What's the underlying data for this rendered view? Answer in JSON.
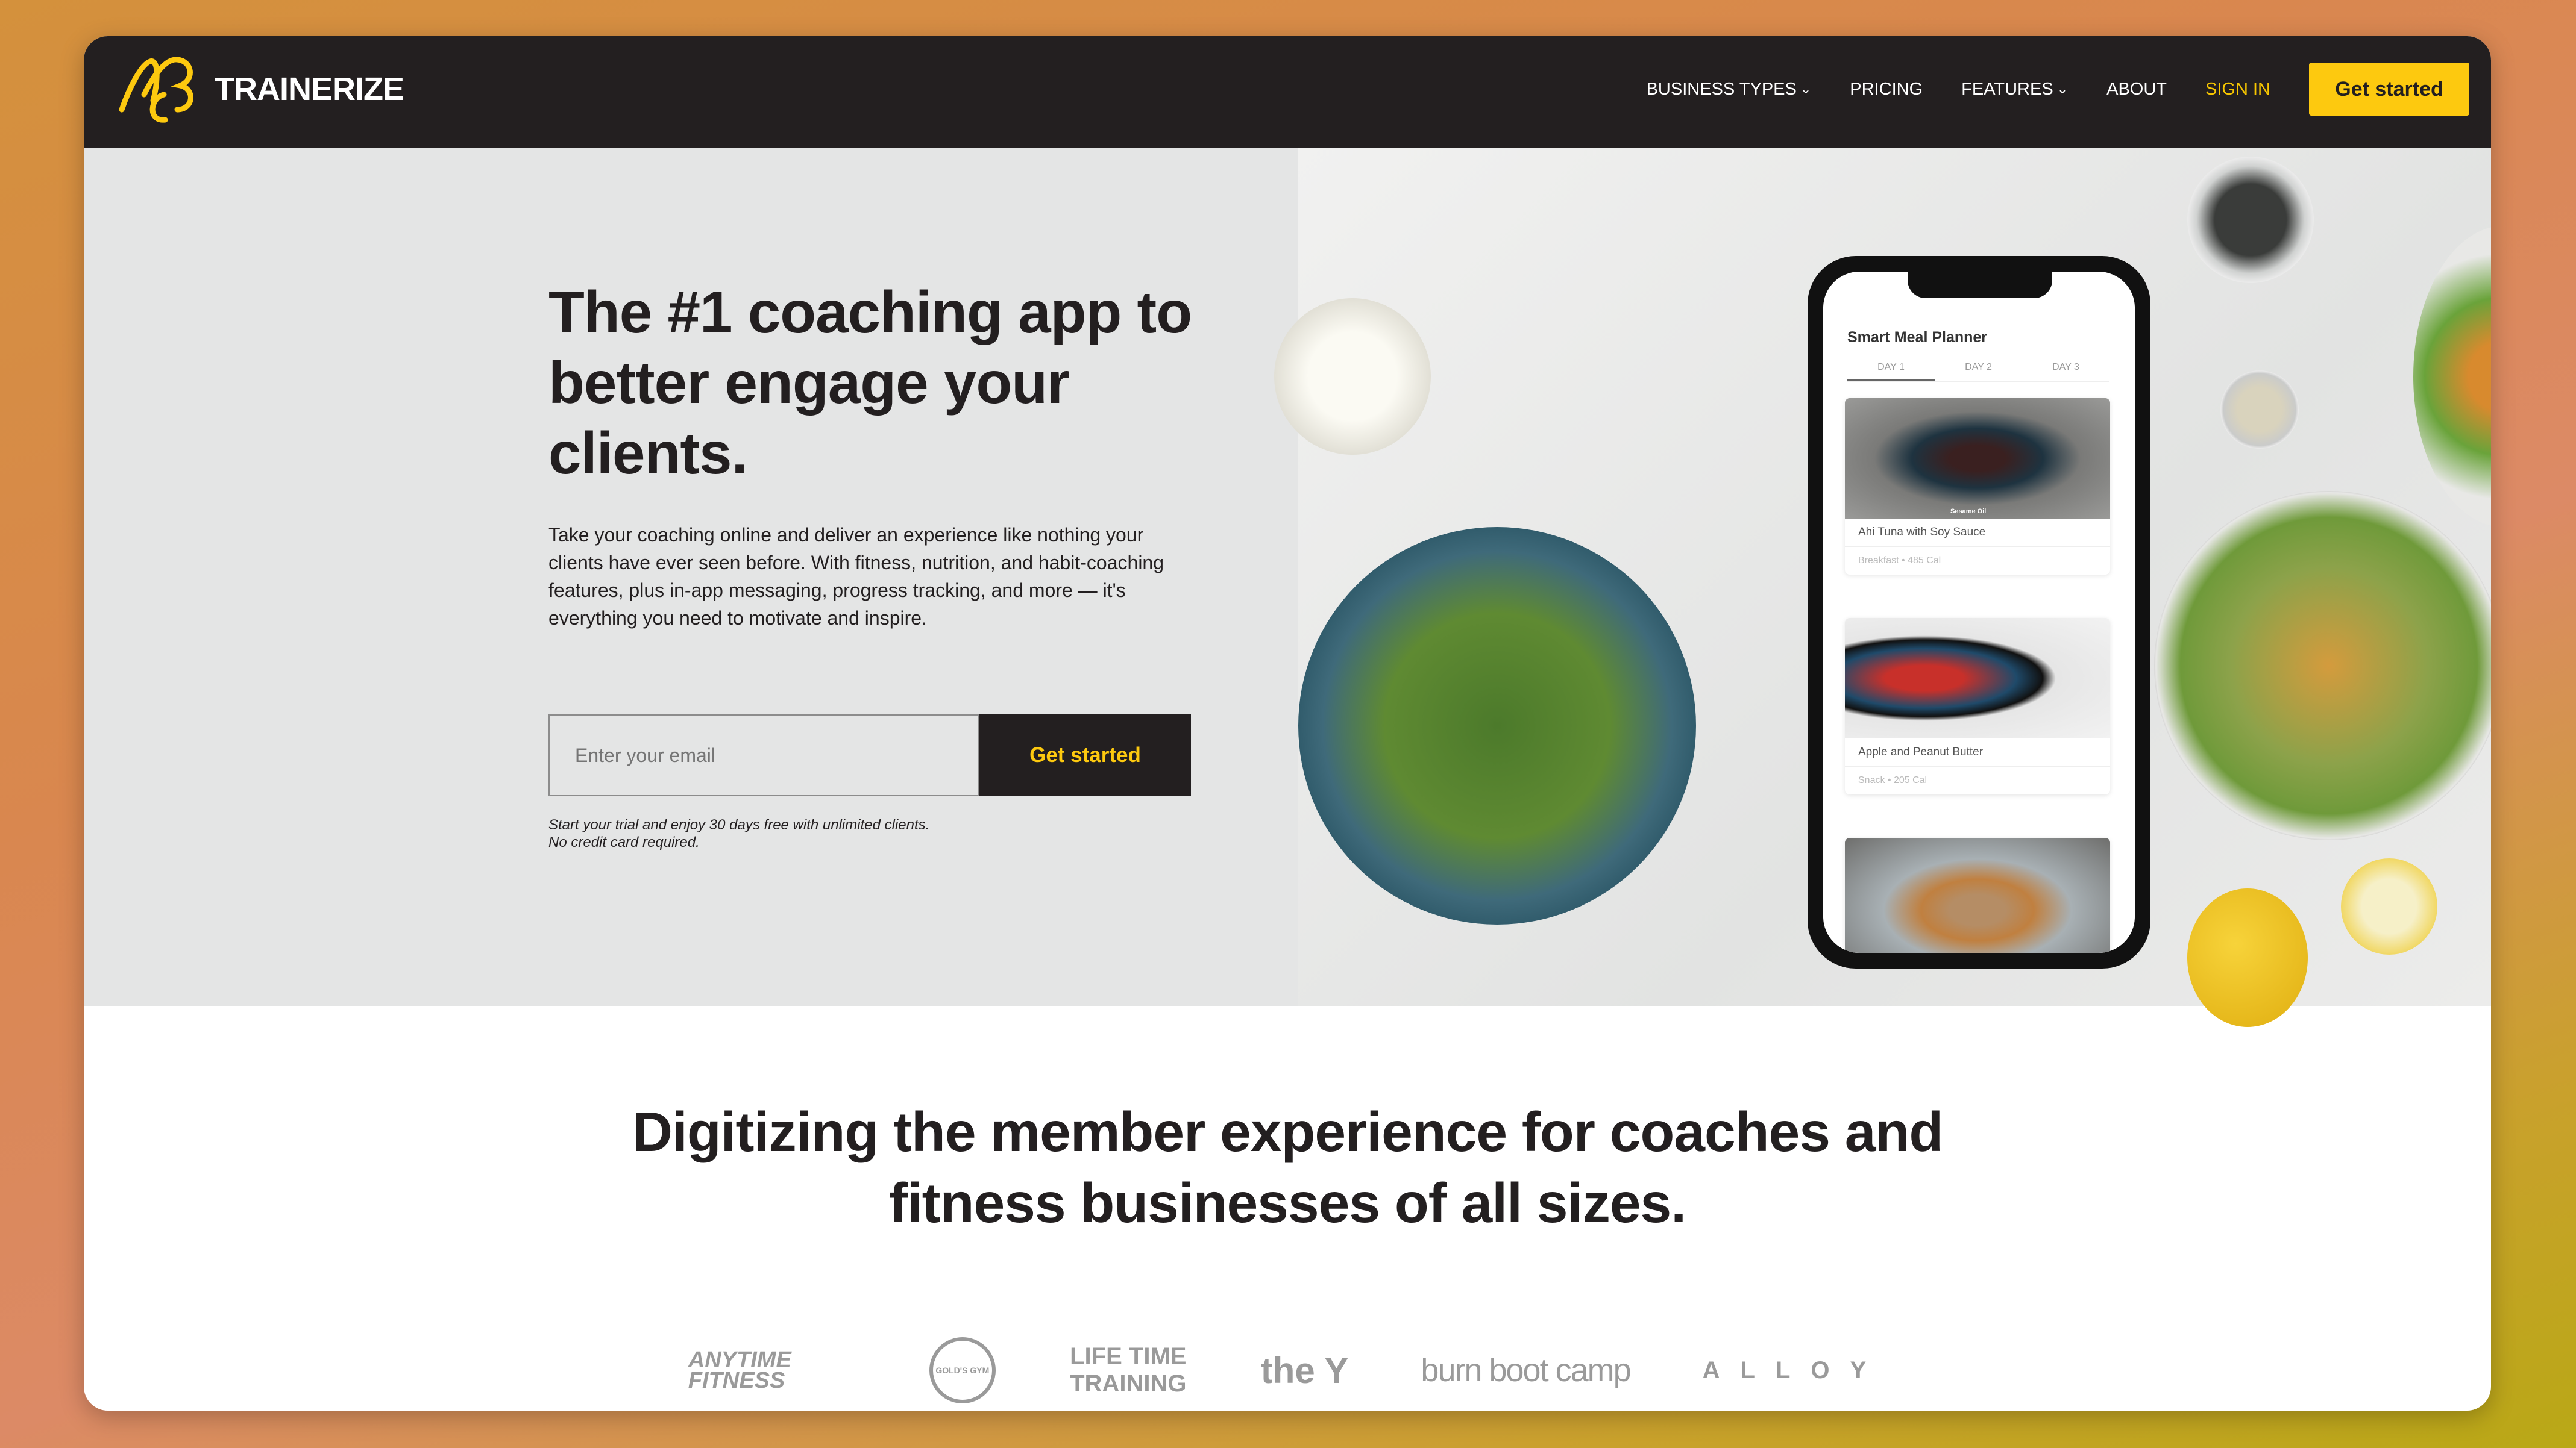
{
  "nav": {
    "brand": "TRAINERIZE",
    "items": [
      {
        "label": "BUSINESS TYPES",
        "dropdown": true
      },
      {
        "label": "PRICING",
        "dropdown": false
      },
      {
        "label": "FEATURES",
        "dropdown": true
      },
      {
        "label": "ABOUT",
        "dropdown": false
      }
    ],
    "sign_in": "SIGN IN",
    "cta": "Get started"
  },
  "hero": {
    "title": "The #1 coaching app to better engage your clients.",
    "lead": "Take your coaching online and deliver an experience like nothing your clients have ever seen before. With fitness, nutrition, and habit-coaching features, plus in-app messaging, progress tracking, and more — it's everything you need to motivate and inspire.",
    "email_placeholder": "Enter your email",
    "email_value": "",
    "cta": "Get started",
    "note_line1": "Start your trial and enjoy 30 days free with unlimited clients.",
    "note_line2": "No credit card required."
  },
  "phone": {
    "title": "Smart Meal Planner",
    "tabs": [
      "DAY 1",
      "DAY 2",
      "DAY 3"
    ],
    "meals": [
      {
        "name": "Ahi Tuna with Soy Sauce",
        "meta": "Breakfast • 485 Cal",
        "image_label": "Sesame Oil"
      },
      {
        "name": "Apple and Peanut Butter",
        "meta": "Snack • 205 Cal"
      }
    ]
  },
  "section2": {
    "title_line1": "Digitizing the member experience for coaches and",
    "title_line2": "fitness businesses of all sizes."
  },
  "logos": [
    "ANYTIME FITNESS",
    "GOLD'S GYM",
    "LIFE TIME TRAINING",
    "the Y",
    "burn boot camp",
    "ALLOY"
  ],
  "colors": {
    "brand_yellow": "#fdc90f",
    "dark": "#231f20",
    "hero_bg": "#e4e5e5"
  }
}
